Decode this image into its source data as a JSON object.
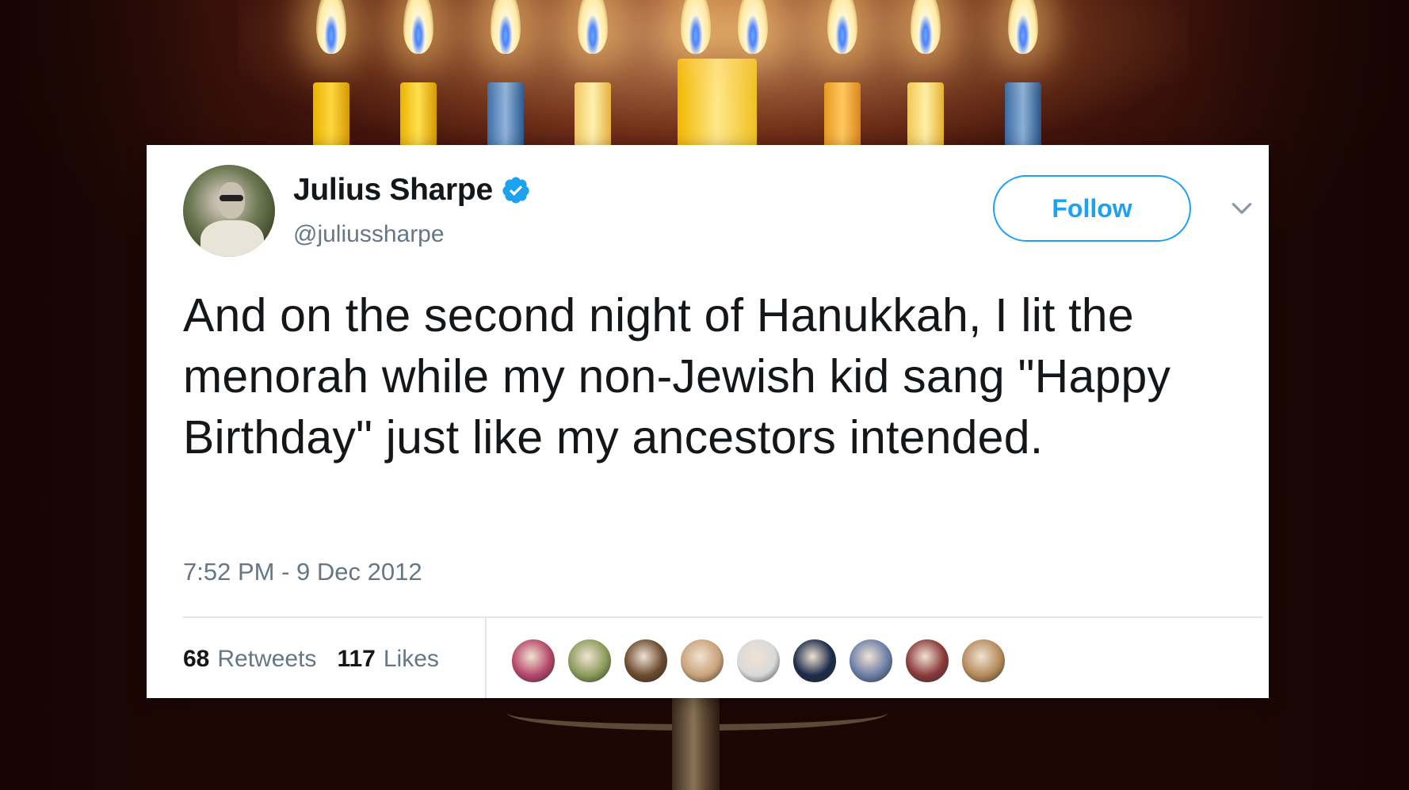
{
  "tweet": {
    "display_name": "Julius Sharpe",
    "handle": "@juliussharpe",
    "verified": true,
    "follow_label": "Follow",
    "text": "And on the second night of Hanukkah, I lit the menorah while my non-Jewish kid sang \"Happy Birthday\" just like my ancestors intended.",
    "timestamp": "7:52 PM - 9 Dec 2012",
    "retweets_count": "68",
    "retweets_label": "Retweets",
    "likes_count": "117",
    "likes_label": "Likes"
  },
  "likers": [
    {
      "color": "#b5466a"
    },
    {
      "color": "#8a9b5a"
    },
    {
      "color": "#6b4a2e"
    },
    {
      "color": "#c9a27a"
    },
    {
      "color": "#d9d9d9"
    },
    {
      "color": "#1b2b4a"
    },
    {
      "color": "#6a7ea8"
    },
    {
      "color": "#8a3a3a"
    },
    {
      "color": "#b58a5a"
    }
  ],
  "colors": {
    "accent": "#1da1f2",
    "text": "#14171a",
    "secondary_text": "#657786"
  },
  "icons": {
    "verified": "verified-badge-icon",
    "chevron": "chevron-down-icon"
  }
}
